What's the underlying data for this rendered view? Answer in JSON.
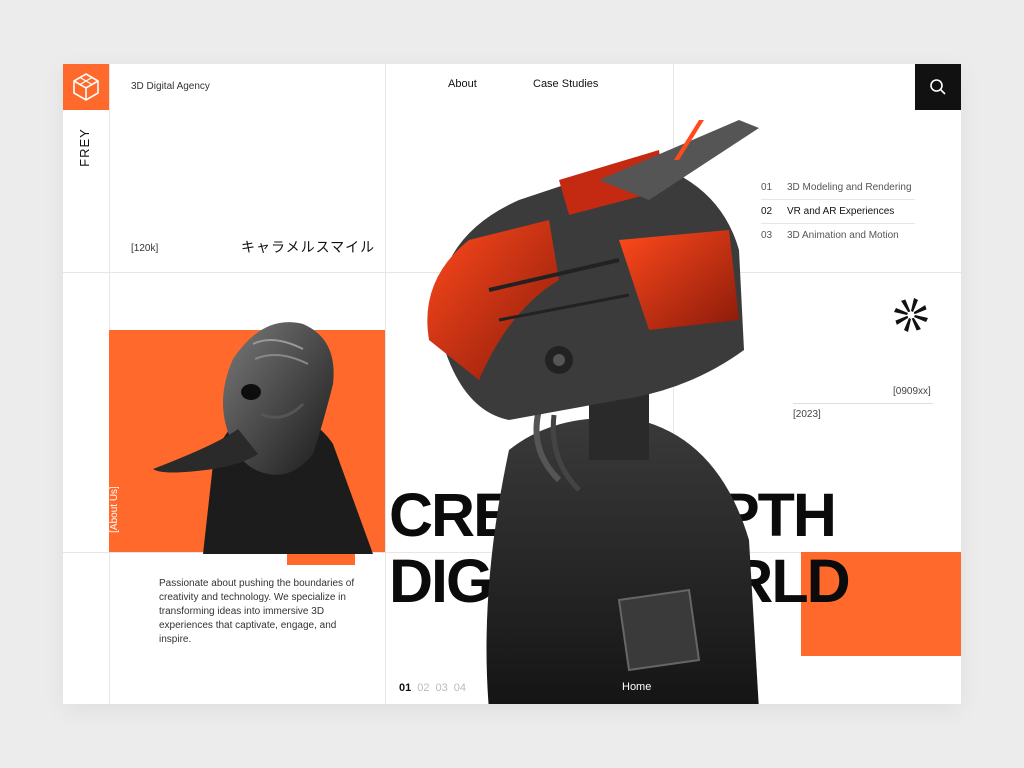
{
  "brand": {
    "name": "FREY",
    "tagline": "3D Digital Agency"
  },
  "nav": {
    "about": "About",
    "case_studies": "Case Studies"
  },
  "stats": {
    "count": "[120k]",
    "japanese": "キャラメルスマイル"
  },
  "services": [
    {
      "num": "01",
      "label": "3D Modeling and Rendering",
      "active": false
    },
    {
      "num": "02",
      "label": "VR and AR Experiences",
      "active": true
    },
    {
      "num": "03",
      "label": "3D Animation and Motion",
      "active": false
    }
  ],
  "tags": {
    "code": "[0909xx]",
    "year": "[2023]"
  },
  "about": {
    "label": "[About Us]",
    "description": "Passionate about pushing the boundaries of creativity and technology. We specialize in transforming ideas into immersive 3D experiences that captivate, engage, and inspire."
  },
  "hero": {
    "line1": "CREATE DEPTH",
    "line2": "DIGITAL WORLD"
  },
  "pager": [
    "01",
    "02",
    "03",
    "04"
  ],
  "home_label": "Home",
  "colors": {
    "accent": "#ff6a2c",
    "dark": "#111111",
    "background": "#ececec"
  },
  "icons": [
    "hexagon-logo-icon",
    "search-icon",
    "arrow-right-icon",
    "spiral-icon"
  ]
}
